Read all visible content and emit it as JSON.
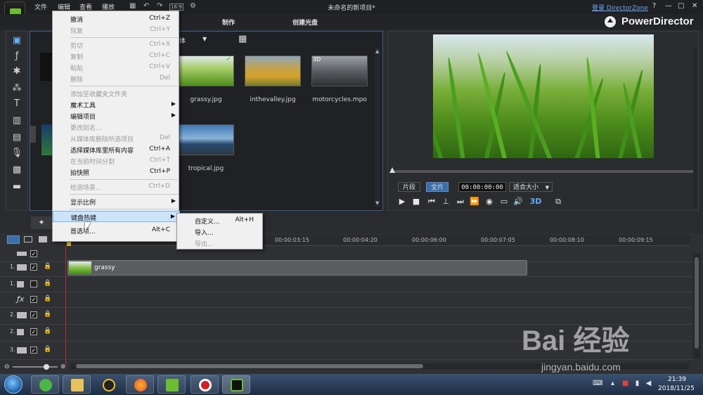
{
  "window": {
    "title": "未命名的新项目*",
    "login_link": "登录 DirectorZone",
    "help": "?",
    "minimize": "—",
    "maximize": "□",
    "close": "✕",
    "aspect": "16:9"
  },
  "menubar": {
    "items": [
      "文件",
      "编辑",
      "查看",
      "播放"
    ]
  },
  "modes": [
    "制作",
    "创建光盘"
  ],
  "brand": "PowerDirector",
  "library": {
    "items": [
      {
        "label": "grassy.jpg",
        "checked": true
      },
      {
        "label": "inthevalley.jpg"
      },
      {
        "label": "motorcycles.mpo",
        "badge": "3D"
      },
      {
        "label": "tropical.jpg"
      }
    ],
    "filter_fragment": "体"
  },
  "preview": {
    "clip_tab": "片段",
    "movie_tab": "全片",
    "timecode": "00:00:00:00",
    "fit": "适合大小",
    "mode_3d": "3D"
  },
  "timeline": {
    "ticks": [
      "00:00:03:15",
      "00:00:04:20",
      "00:00:06:00",
      "00:00:07:05",
      "00:00:08:10",
      "00:00:09:15"
    ],
    "tracks": [
      {
        "num": "",
        "type": "chapter",
        "checked": true
      },
      {
        "num": "1.",
        "type": "video",
        "checked": true
      },
      {
        "num": "1.",
        "type": "audio",
        "checked": false
      },
      {
        "num": "",
        "type": "fx",
        "checked": true
      },
      {
        "num": "2.",
        "type": "video",
        "checked": true
      },
      {
        "num": "2.",
        "type": "audio",
        "checked": true
      },
      {
        "num": "3.",
        "type": "video",
        "checked": true
      }
    ],
    "clip_label": "grassy"
  },
  "edit_menu": {
    "items": [
      {
        "label": "撤消",
        "key": "Ctrl+Z",
        "disabled": false
      },
      {
        "label": "恢复",
        "key": "Ctrl+Y",
        "disabled": true
      },
      {
        "sep": true
      },
      {
        "label": "剪切",
        "key": "Ctrl+X",
        "disabled": true
      },
      {
        "label": "复制",
        "key": "Ctrl+C",
        "disabled": true
      },
      {
        "label": "粘贴",
        "key": "Ctrl+V",
        "disabled": true
      },
      {
        "label": "删除",
        "key": "Del",
        "disabled": true
      },
      {
        "sep": true
      },
      {
        "label": "添加至收藏夹文件夹",
        "key": "",
        "disabled": true
      },
      {
        "label": "魔术工具",
        "key": "",
        "disabled": false,
        "submenu": true
      },
      {
        "label": "编辑项目",
        "key": "",
        "disabled": false,
        "submenu": true
      },
      {
        "label": "更改别名...",
        "key": "",
        "disabled": true
      },
      {
        "label": "从媒体库删除所选项目",
        "key": "Del",
        "disabled": true
      },
      {
        "label": "选择媒体库里所有内容",
        "key": "Ctrl+A",
        "disabled": false
      },
      {
        "label": "在当前时间分割",
        "key": "Ctrl+T",
        "disabled": true
      },
      {
        "label": "拍快照",
        "key": "Ctrl+P",
        "disabled": false
      },
      {
        "sep": true
      },
      {
        "label": "检测场景...",
        "key": "Ctrl+D",
        "disabled": true
      },
      {
        "sep": true
      },
      {
        "label": "显示比例",
        "key": "",
        "disabled": false,
        "submenu": true
      },
      {
        "sep": true
      },
      {
        "label": "键盘热键",
        "key": "",
        "disabled": false,
        "submenu": true,
        "highlight": true
      },
      {
        "label": "首选项...",
        "key": "Alt+C",
        "disabled": false
      }
    ]
  },
  "hotkey_submenu": {
    "items": [
      {
        "label": "自定义...",
        "key": "Alt+H",
        "disabled": false
      },
      {
        "label": "导入...",
        "key": "",
        "disabled": false
      },
      {
        "label": "导出...",
        "key": "",
        "disabled": true
      }
    ]
  },
  "taskbar": {
    "time": "21:39",
    "date": "2018/11/25"
  },
  "watermark": {
    "brand": "Bai  经验",
    "url": "jingyan.baidu.com"
  }
}
